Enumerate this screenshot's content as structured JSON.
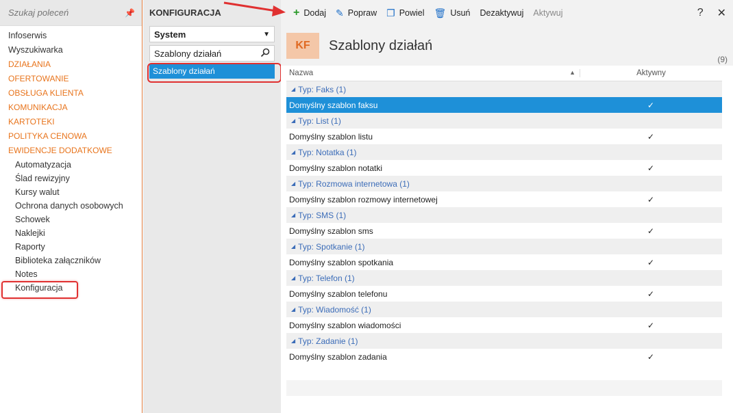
{
  "leftnav": {
    "search_placeholder": "Szukaj poleceń",
    "items": [
      {
        "label": "Infoserwis",
        "type": "item"
      },
      {
        "label": "Wyszukiwarka",
        "type": "item"
      },
      {
        "label": "DZIAŁANIA",
        "type": "section"
      },
      {
        "label": "OFERTOWANIE",
        "type": "section"
      },
      {
        "label": "OBSŁUGA KLIENTA",
        "type": "section"
      },
      {
        "label": "KOMUNIKACJA",
        "type": "section"
      },
      {
        "label": "KARTOTEKI",
        "type": "section"
      },
      {
        "label": "POLITYKA CENOWA",
        "type": "section"
      },
      {
        "label": "EWIDENCJE DODATKOWE",
        "type": "section"
      },
      {
        "label": "Automatyzacja",
        "type": "sub"
      },
      {
        "label": "Ślad rewizyjny",
        "type": "sub"
      },
      {
        "label": "Kursy walut",
        "type": "sub"
      },
      {
        "label": "Ochrona danych osobowych",
        "type": "sub"
      },
      {
        "label": "Schowek",
        "type": "sub"
      },
      {
        "label": "Naklejki",
        "type": "sub"
      },
      {
        "label": "Raporty",
        "type": "sub"
      },
      {
        "label": "Biblioteka załączników",
        "type": "sub"
      },
      {
        "label": "Notes",
        "type": "sub"
      },
      {
        "label": "Konfiguracja",
        "type": "sub",
        "highlight": true
      }
    ]
  },
  "midpanel": {
    "title": "KONFIGURACJA",
    "select_value": "System",
    "filter_value": "Szablony działań",
    "tree_item": "Szablony działań"
  },
  "toolbar": {
    "add": "Dodaj",
    "edit": "Popraw",
    "duplicate": "Powiel",
    "delete": "Usuń",
    "deactivate": "Dezaktywuj",
    "activate": "Aktywuj",
    "help": "?",
    "close": "✕"
  },
  "header": {
    "badge": "KF",
    "title": "Szablony działań",
    "count": "(9)"
  },
  "grid": {
    "col_name": "Nazwa",
    "col_active": "Aktywny",
    "rows": [
      {
        "kind": "group",
        "label": "Typ: Faks (1)"
      },
      {
        "kind": "data",
        "name": "Domyślny szablon faksu",
        "active": "✓",
        "selected": true
      },
      {
        "kind": "group",
        "label": "Typ: List (1)"
      },
      {
        "kind": "data",
        "name": "Domyślny szablon listu",
        "active": "✓"
      },
      {
        "kind": "group",
        "label": "Typ: Notatka (1)"
      },
      {
        "kind": "data",
        "name": "Domyślny szablon notatki",
        "active": "✓"
      },
      {
        "kind": "group",
        "label": "Typ: Rozmowa internetowa (1)"
      },
      {
        "kind": "data",
        "name": "Domyślny szablon rozmowy internetowej",
        "active": "✓"
      },
      {
        "kind": "group",
        "label": "Typ: SMS (1)"
      },
      {
        "kind": "data",
        "name": "Domyślny szablon sms",
        "active": "✓"
      },
      {
        "kind": "group",
        "label": "Typ: Spotkanie (1)"
      },
      {
        "kind": "data",
        "name": "Domyślny szablon spotkania",
        "active": "✓"
      },
      {
        "kind": "group",
        "label": "Typ: Telefon (1)"
      },
      {
        "kind": "data",
        "name": "Domyślny szablon telefonu",
        "active": "✓"
      },
      {
        "kind": "group",
        "label": "Typ: Wiadomość (1)"
      },
      {
        "kind": "data",
        "name": "Domyślny szablon wiadomości",
        "active": "✓"
      },
      {
        "kind": "group",
        "label": "Typ: Zadanie (1)"
      },
      {
        "kind": "data",
        "name": "Domyślny szablon zadania",
        "active": "✓"
      }
    ]
  },
  "colors": {
    "accent_orange": "#e8741c",
    "selection_blue": "#1e90d8",
    "group_text": "#3b6cb8",
    "annotation_red": "#e03030"
  }
}
